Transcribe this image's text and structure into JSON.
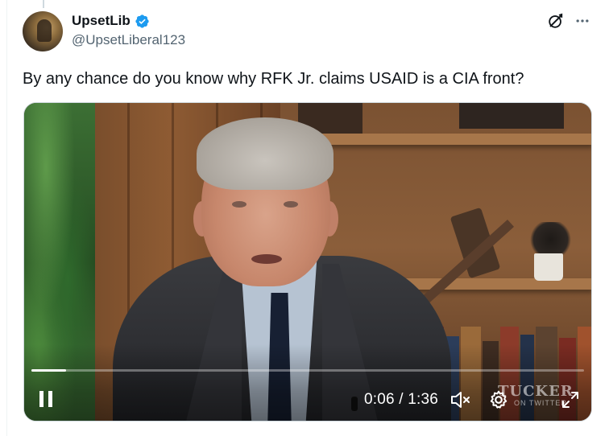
{
  "post": {
    "author": {
      "display_name": "UpsetLib",
      "handle": "@UpsetLiberal123",
      "verified": true,
      "verified_color": "#1d9bf0"
    },
    "text": "By any chance do you know why RFK Jr. claims USAID is a CIA front?",
    "actions": {
      "grok_icon": "grok-icon",
      "more_icon": "more-icon"
    }
  },
  "video": {
    "state": "playing",
    "current_time": "0:06",
    "duration": "1:36",
    "time_display": "0:06 / 1:36",
    "progress_fraction": 0.062,
    "muted": true,
    "watermark_main": "TUCKER",
    "watermark_sub": "ON TWITTER",
    "controls": {
      "pause_icon": "pause-icon",
      "mute_icon": "volume-muted-icon",
      "settings_icon": "gear-icon",
      "fullscreen_icon": "fullscreen-icon"
    }
  }
}
